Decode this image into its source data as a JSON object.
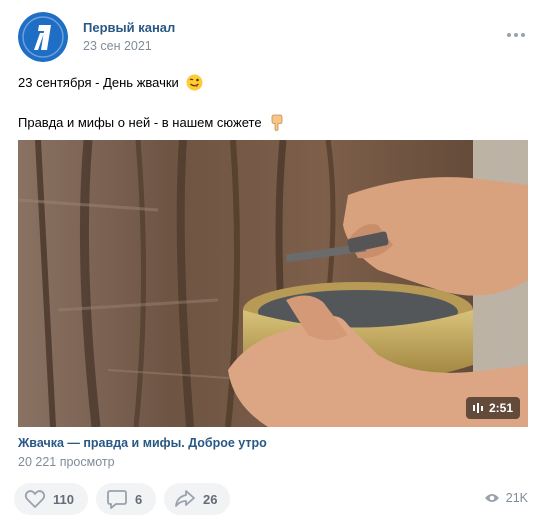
{
  "post": {
    "author": "Первый канал",
    "date": "23 сен 2021",
    "text_line1": "23 сентября - День жвачки",
    "text_line2": "Правда и мифы о ней - в нашем сюжете",
    "emoji1": "winking-face-with-tongue-emoji",
    "emoji2": "backhand-index-pointing-down-emoji"
  },
  "video": {
    "duration": "2:51",
    "title": "Жвачка — правда и мифы. Доброе утро",
    "views_text": "20 221 просмотр"
  },
  "actions": {
    "likes": "110",
    "comments": "6",
    "shares": "26",
    "views": "21K"
  },
  "colors": {
    "link": "#2a5885",
    "secondary": "#818c99",
    "button_bg": "#f2f3f5",
    "logo_blue": "#1f6ec6"
  },
  "icons": [
    "channel-one-logo",
    "more-icon",
    "like-icon",
    "comment-icon",
    "share-icon",
    "eye-icon",
    "video-icon"
  ]
}
